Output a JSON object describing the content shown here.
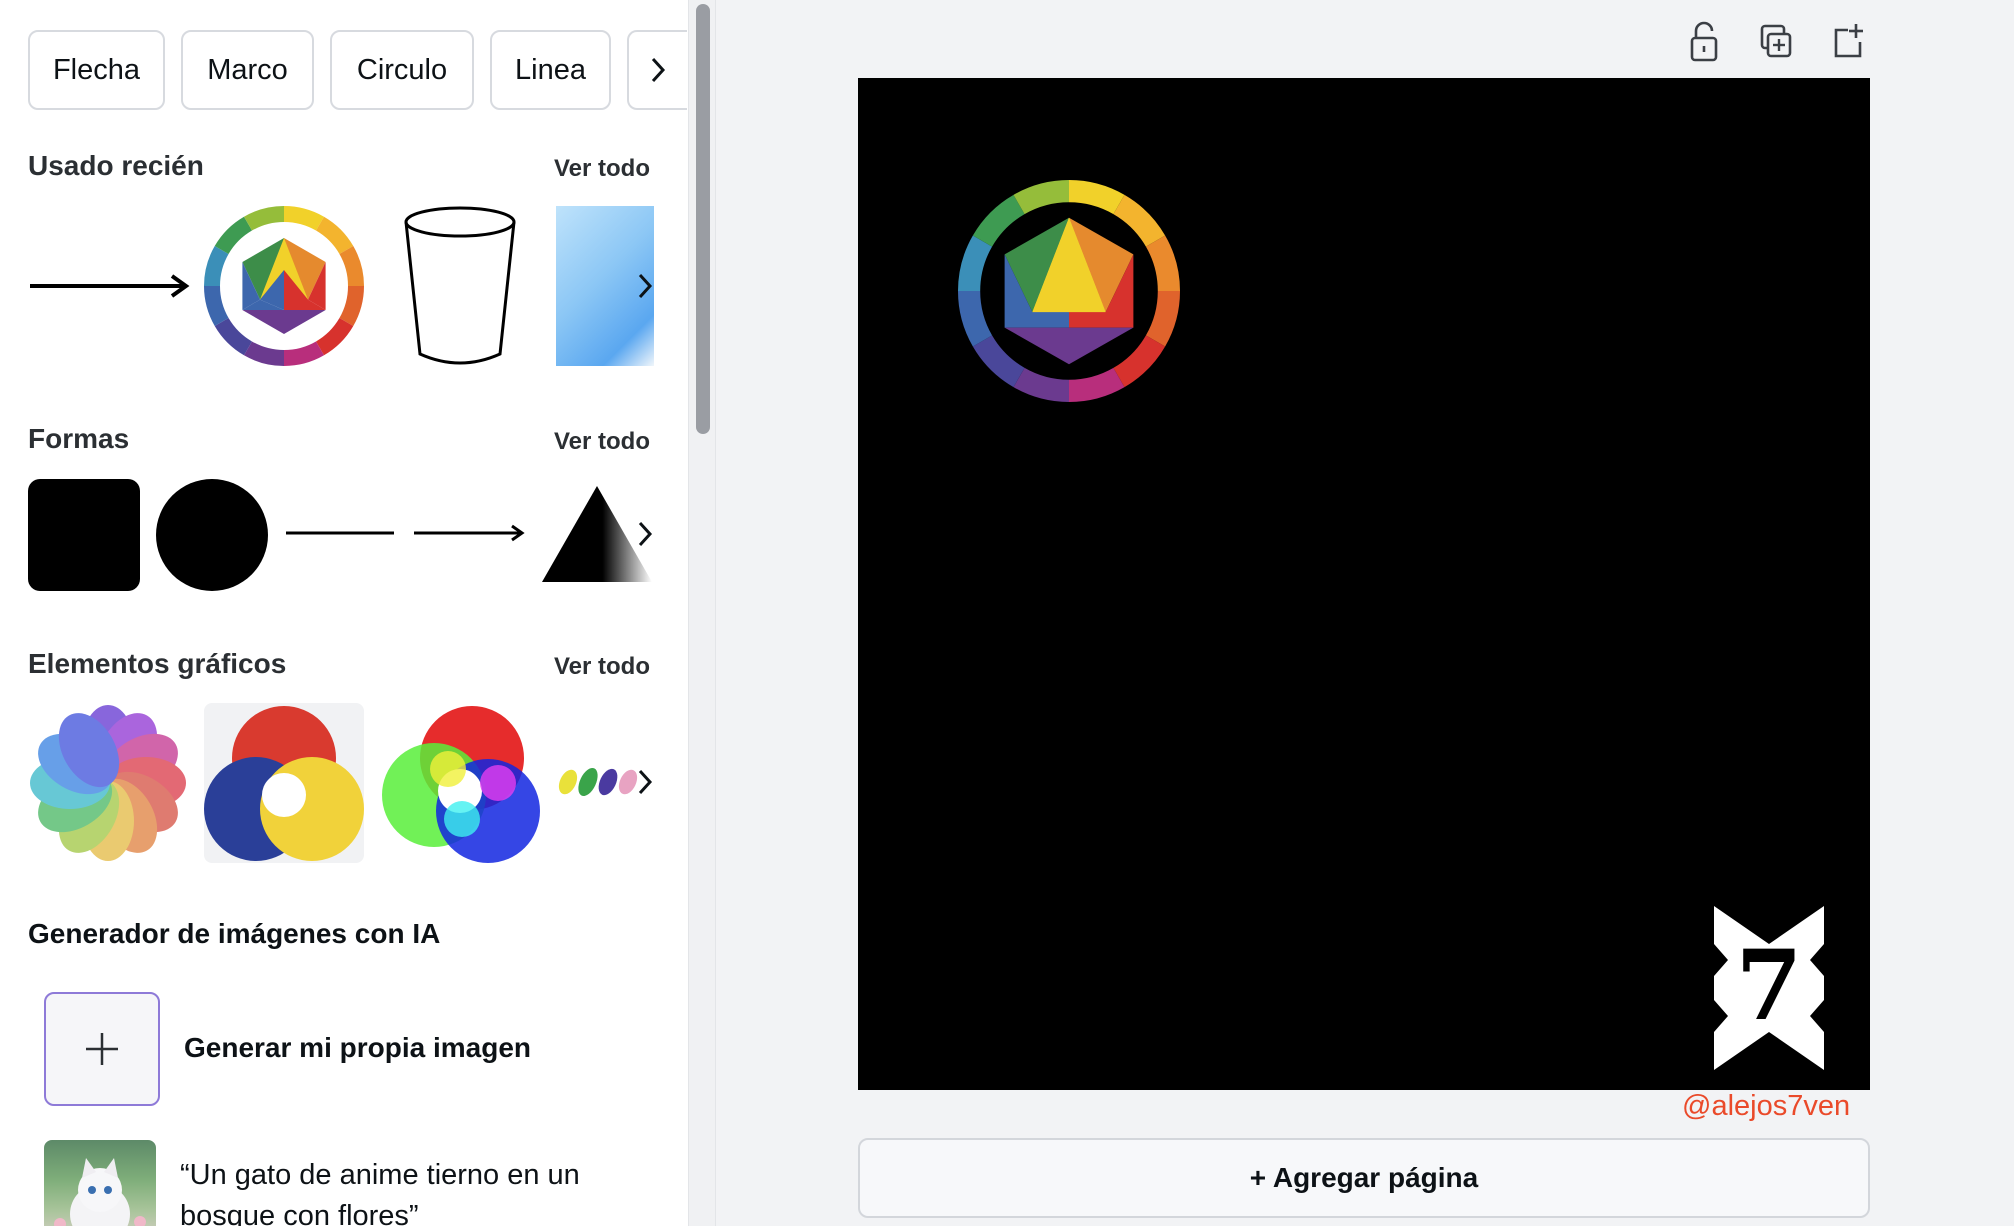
{
  "search_chips": [
    "Flecha",
    "Marco",
    "Circulo",
    "Linea"
  ],
  "icons": {
    "chips_next": "chevron-right-icon",
    "row_next": "chevron-right-icon",
    "ai_add": "plus-icon",
    "lock": "unlock-icon",
    "duplicate": "duplicate-page-icon",
    "add_page": "add-page-icon"
  },
  "sections": {
    "recent": {
      "title": "Usado recién",
      "see_all": "Ver todo",
      "items": [
        "arrow",
        "color-wheel",
        "cup-outline",
        "blue-gradient"
      ]
    },
    "shapes": {
      "title": "Formas",
      "see_all": "Ver todo",
      "items": [
        "rounded-square",
        "circle",
        "line",
        "arrow-line",
        "triangle"
      ]
    },
    "graphics": {
      "title": "Elementos gráficos",
      "see_all": "Ver todo",
      "items": [
        "color-spiral",
        "subtractive-venn",
        "additive-venn",
        "paint-strokes"
      ]
    },
    "ai": {
      "title": "Generador de imágenes con IA",
      "generate_label": "Generar mi propia imagen",
      "prompt_example": "“Un gato de anime tierno en un bosque con flores”"
    }
  },
  "canvas": {
    "background": "#000000",
    "elements": [
      "color-wheel",
      "x7-logo"
    ],
    "logo_text": "7"
  },
  "watermark": "@alejos7ven",
  "add_page_label": "+ Agregar página",
  "colors": {
    "accent_purple": "#8e7ad8",
    "watermark": "#ea4a2a"
  }
}
